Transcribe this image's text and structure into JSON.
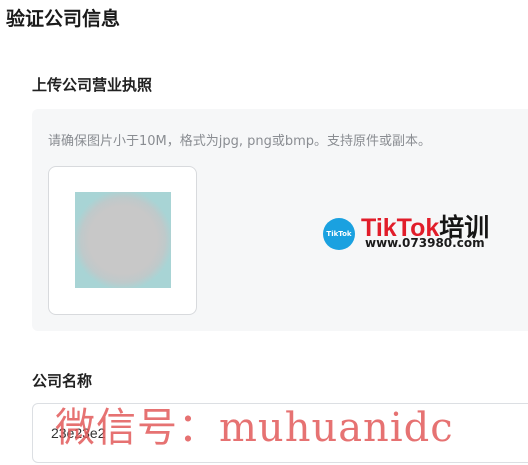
{
  "page": {
    "title": "验证公司信息"
  },
  "upload": {
    "section_title": "上传公司营业执照",
    "hint": "请确保图片小于10M，格式为jpg, png或bmp。支持原件或副本。"
  },
  "watermark": {
    "badge": "TikTok",
    "logo_main": "TikTok",
    "logo_cn": "培训",
    "logo_url": "www.073980.com",
    "overlay": "微信号：muhuanidc"
  },
  "company": {
    "label": "公司名称",
    "value": "23e23e2"
  },
  "colors": {
    "accent_red": "#e11d2a",
    "badge_blue": "#1aa1e0",
    "panel_bg": "#f6f7f8"
  }
}
